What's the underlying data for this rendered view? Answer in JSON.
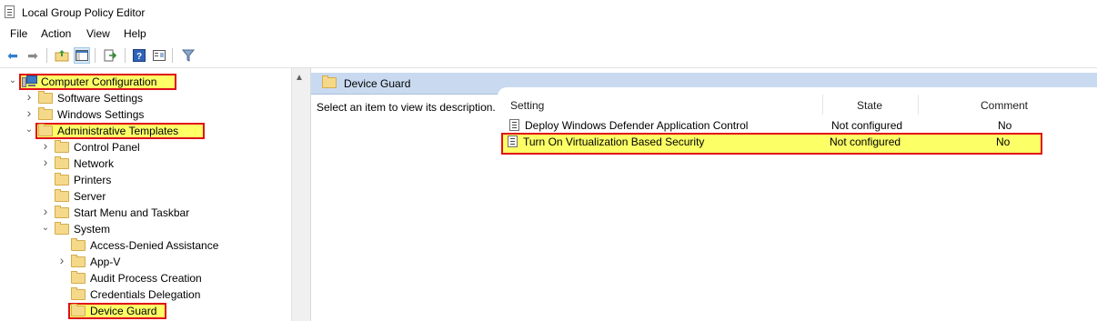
{
  "window": {
    "title": "Local Group Policy Editor"
  },
  "menu": [
    "File",
    "Action",
    "View",
    "Help"
  ],
  "toolbar": {
    "buttons": [
      "back-icon",
      "forward-icon",
      "up-folder-icon",
      "show-hide-tree-icon",
      "export-list-icon",
      "help-icon",
      "properties-view-icon",
      "filter-icon"
    ]
  },
  "tree": [
    {
      "label": "Computer Configuration",
      "depth": 0,
      "chevron": "expanded",
      "icon": "computer-icon",
      "highlighted": true
    },
    {
      "label": "Software Settings",
      "depth": 1,
      "chevron": "collapsed",
      "icon": "folder-icon"
    },
    {
      "label": "Windows Settings",
      "depth": 1,
      "chevron": "collapsed",
      "icon": "folder-icon"
    },
    {
      "label": "Administrative Templates",
      "depth": 1,
      "chevron": "expanded",
      "icon": "folder-icon",
      "highlighted": true
    },
    {
      "label": "Control Panel",
      "depth": 2,
      "chevron": "collapsed",
      "icon": "folder-icon"
    },
    {
      "label": "Network",
      "depth": 2,
      "chevron": "collapsed",
      "icon": "folder-icon"
    },
    {
      "label": "Printers",
      "depth": 2,
      "chevron": "none",
      "icon": "folder-icon"
    },
    {
      "label": "Server",
      "depth": 2,
      "chevron": "none",
      "icon": "folder-icon"
    },
    {
      "label": "Start Menu and Taskbar",
      "depth": 2,
      "chevron": "collapsed",
      "icon": "folder-icon"
    },
    {
      "label": "System",
      "depth": 2,
      "chevron": "expanded",
      "icon": "folder-icon"
    },
    {
      "label": "Access-Denied Assistance",
      "depth": 3,
      "chevron": "none",
      "icon": "folder-icon"
    },
    {
      "label": "App-V",
      "depth": 3,
      "chevron": "collapsed",
      "icon": "folder-icon"
    },
    {
      "label": "Audit Process Creation",
      "depth": 3,
      "chevron": "none",
      "icon": "folder-icon"
    },
    {
      "label": "Credentials Delegation",
      "depth": 3,
      "chevron": "none",
      "icon": "folder-icon"
    },
    {
      "label": "Device Guard",
      "depth": 3,
      "chevron": "none",
      "icon": "folder-icon",
      "highlighted": true
    }
  ],
  "right_pane": {
    "header_title": "Device Guard",
    "description": "Select an item to view its description.",
    "columns": {
      "setting": "Setting",
      "state": "State",
      "comment": "Comment"
    },
    "rows": [
      {
        "setting": "Deploy Windows Defender Application Control",
        "state": "Not configured",
        "comment": "No",
        "highlighted": false
      },
      {
        "setting": "Turn On Virtualization Based Security",
        "state": "Not configured",
        "comment": "No",
        "highlighted": true
      }
    ]
  },
  "colors": {
    "highlight_fill": "#fcff66",
    "highlight_border": "#e0101a",
    "header_blue": "#c9daf0"
  }
}
